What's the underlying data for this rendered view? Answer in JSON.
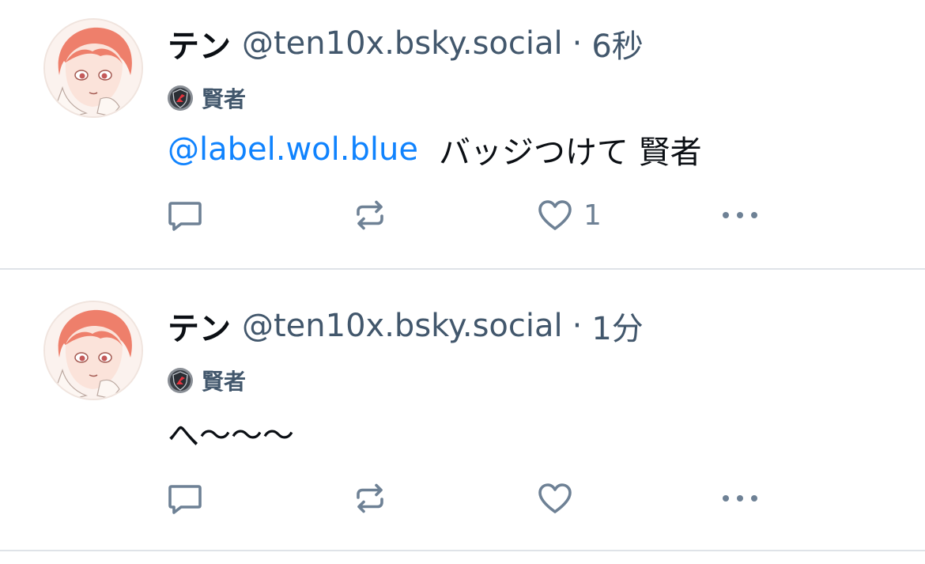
{
  "posts": [
    {
      "display_name": "テン",
      "handle": "@ten10x.bsky.social",
      "separator": "·",
      "time": "6秒",
      "label": "賢者",
      "mention": "@label.wol.blue",
      "text": "バッジつけて 賢者",
      "like_count": "1",
      "icons": {
        "reply": "reply-icon",
        "repost": "repost-icon",
        "like": "heart-icon",
        "more": "more-icon",
        "label": "shield-badge-icon"
      }
    },
    {
      "display_name": "テン",
      "handle": "@ten10x.bsky.social",
      "separator": "·",
      "time": "1分",
      "label": "賢者",
      "mention": "",
      "text": "へ〜〜〜",
      "like_count": "",
      "icons": {
        "reply": "reply-icon",
        "repost": "repost-icon",
        "like": "heart-icon",
        "more": "more-icon",
        "label": "shield-badge-icon"
      }
    }
  ],
  "colors": {
    "text": "#0b0f14",
    "secondary": "#42576c",
    "icon": "#6e8195",
    "mention": "#1083fe",
    "divider": "#dfe3e8"
  }
}
